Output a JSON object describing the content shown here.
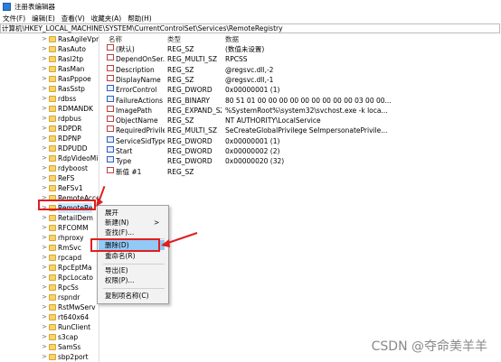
{
  "window": {
    "title": "注册表编辑器"
  },
  "menubar": [
    "文件(F)",
    "编辑(E)",
    "查看(V)",
    "收藏夹(A)",
    "帮助(H)"
  ],
  "address": "计算机\\HKEY_LOCAL_MACHINE\\SYSTEM\\CurrentControlSet\\Services\\RemoteRegistry",
  "tree_items": [
    "RasAgileVpn",
    "RasAuto",
    "Rasl2tp",
    "RasMan",
    "RasPppoe",
    "RasSstp",
    "rdbss",
    "RDMANDK",
    "rdpbus",
    "RDPDR",
    "RDPNP",
    "RDPUDD",
    "RdpVideoMi",
    "rdyboost",
    "ReFS",
    "ReFSv1",
    "RemoteAcces",
    "RemoteRe",
    "RetailDem",
    "RFCOMM",
    "rhproxy",
    "RmSvc",
    "rpcapd",
    "RpcEptMa",
    "RpcLocato",
    "RpcSs",
    "rspndr",
    "RstMwServ",
    "rt640x64",
    "RunClient",
    "s3cap",
    "SamSs",
    "sbp2port"
  ],
  "columns": {
    "name": "名称",
    "type": "类型",
    "data": "数据"
  },
  "values": [
    {
      "icon": "string",
      "name": "(默认)",
      "type": "REG_SZ",
      "data": "(数值未设置)"
    },
    {
      "icon": "string",
      "name": "DependOnSer...",
      "type": "REG_MULTI_SZ",
      "data": "RPCSS"
    },
    {
      "icon": "string",
      "name": "Description",
      "type": "REG_SZ",
      "data": "@regsvc.dll,-2"
    },
    {
      "icon": "string",
      "name": "DisplayName",
      "type": "REG_SZ",
      "data": "@regsvc.dll,-1"
    },
    {
      "icon": "binary",
      "name": "ErrorControl",
      "type": "REG_DWORD",
      "data": "0x00000001 (1)"
    },
    {
      "icon": "binary",
      "name": "FailureActions",
      "type": "REG_BINARY",
      "data": "80 51 01 00 00 00 00 00 00 00 00 00 03 00 00..."
    },
    {
      "icon": "string",
      "name": "ImagePath",
      "type": "REG_EXPAND_SZ",
      "data": "%SystemRoot%\\system32\\svchost.exe -k loca..."
    },
    {
      "icon": "string",
      "name": "ObjectName",
      "type": "REG_SZ",
      "data": "NT AUTHORITY\\LocalService"
    },
    {
      "icon": "string",
      "name": "RequiredPrivile...",
      "type": "REG_MULTI_SZ",
      "data": "SeCreateGlobalPrivilege SeImpersonatePrivile..."
    },
    {
      "icon": "binary",
      "name": "ServiceSidType",
      "type": "REG_DWORD",
      "data": "0x00000001 (1)"
    },
    {
      "icon": "binary",
      "name": "Start",
      "type": "REG_DWORD",
      "data": "0x00000002 (2)"
    },
    {
      "icon": "binary",
      "name": "Type",
      "type": "REG_DWORD",
      "data": "0x00000020 (32)"
    },
    {
      "icon": "string",
      "name": "新值 #1",
      "type": "REG_SZ",
      "data": ""
    }
  ],
  "context_menu": {
    "expand": "展开",
    "new": "新建(N)",
    "submenu_arrow": ">",
    "find": "查找(F)...",
    "delete": "删除(D)",
    "rename": "重命名(R)",
    "export": "导出(E)",
    "permissions": "权限(P)...",
    "copy_key_name": "复制项名称(C)"
  },
  "tree_chevron": ">",
  "watermark": "CSDN @夺命美羊羊",
  "colors": {
    "annotation": "#e01e1e",
    "selection": "#cde8ff",
    "menu_highlight": "#91c9f7"
  }
}
